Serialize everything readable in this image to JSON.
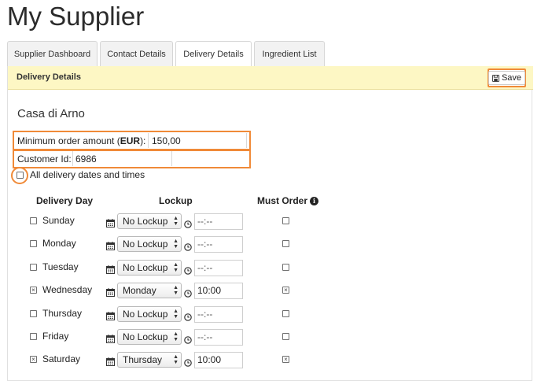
{
  "page": {
    "title": "My Supplier"
  },
  "tabs": [
    {
      "label": "Supplier Dashboard",
      "active": false
    },
    {
      "label": "Contact Details",
      "active": false
    },
    {
      "label": "Delivery Details",
      "active": true
    },
    {
      "label": "Ingredient List",
      "active": false
    }
  ],
  "panel": {
    "title": "Delivery Details",
    "save_label": "Save"
  },
  "supplier": {
    "name": "Casa di Arno",
    "min_order_label_pre": "Minimum order amount (",
    "min_order_currency": "EUR",
    "min_order_label_post": "):",
    "min_order_value": "150,00",
    "customer_id_label": "Customer Id:",
    "customer_id_value": "6986"
  },
  "all_dates": {
    "label": "All delivery dates and times",
    "checked": false
  },
  "columns": {
    "day": "Delivery Day",
    "lockup": "Lockup",
    "must_order": "Must Order"
  },
  "days": [
    {
      "day": "Sunday",
      "checked": false,
      "lockup": "No Lockup",
      "time": "--:--",
      "must_order": false
    },
    {
      "day": "Monday",
      "checked": false,
      "lockup": "No Lockup",
      "time": "--:--",
      "must_order": false
    },
    {
      "day": "Tuesday",
      "checked": false,
      "lockup": "No Lockup",
      "time": "--:--",
      "must_order": false
    },
    {
      "day": "Wednesday",
      "checked": true,
      "lockup": "Monday",
      "time": "10:00",
      "must_order": true
    },
    {
      "day": "Thursday",
      "checked": false,
      "lockup": "No Lockup",
      "time": "--:--",
      "must_order": false
    },
    {
      "day": "Friday",
      "checked": false,
      "lockup": "No Lockup",
      "time": "--:--",
      "must_order": false
    },
    {
      "day": "Saturday",
      "checked": true,
      "lockup": "Thursday",
      "time": "10:00",
      "must_order": true
    }
  ],
  "icons": {
    "save": "floppy-disk-icon",
    "calendar": "calendar-icon",
    "clock": "clock-icon",
    "info": "info-icon"
  },
  "colors": {
    "highlight": "#f08a38",
    "header_bg": "#fdf7c4"
  }
}
